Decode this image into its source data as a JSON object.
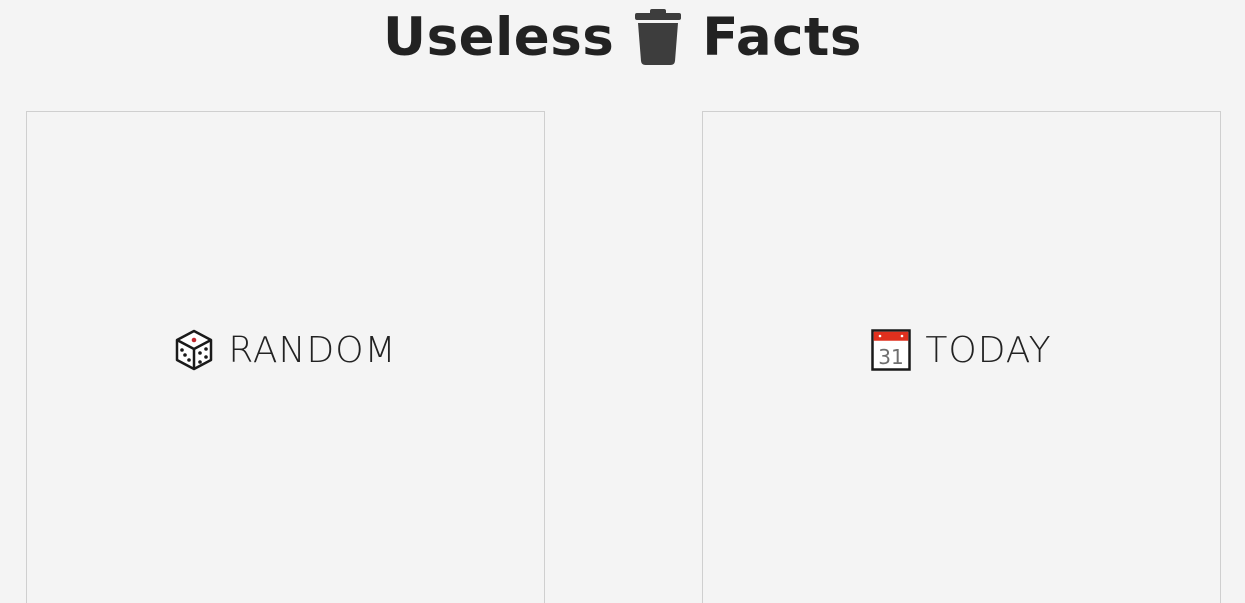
{
  "header": {
    "title_left": "Useless",
    "title_icon": "trash-icon",
    "title_right": "Facts"
  },
  "cards": {
    "random": {
      "icon": "die-icon",
      "label": "RANDOM"
    },
    "today": {
      "icon": "calendar-icon",
      "label": "TODAY",
      "calendar_day": "31"
    }
  },
  "colors": {
    "background": "#f4f4f4",
    "text": "#222222",
    "card_border": "#cfcfcf",
    "icon_dark": "#3d3d3d",
    "calendar_red": "#e0301e"
  }
}
